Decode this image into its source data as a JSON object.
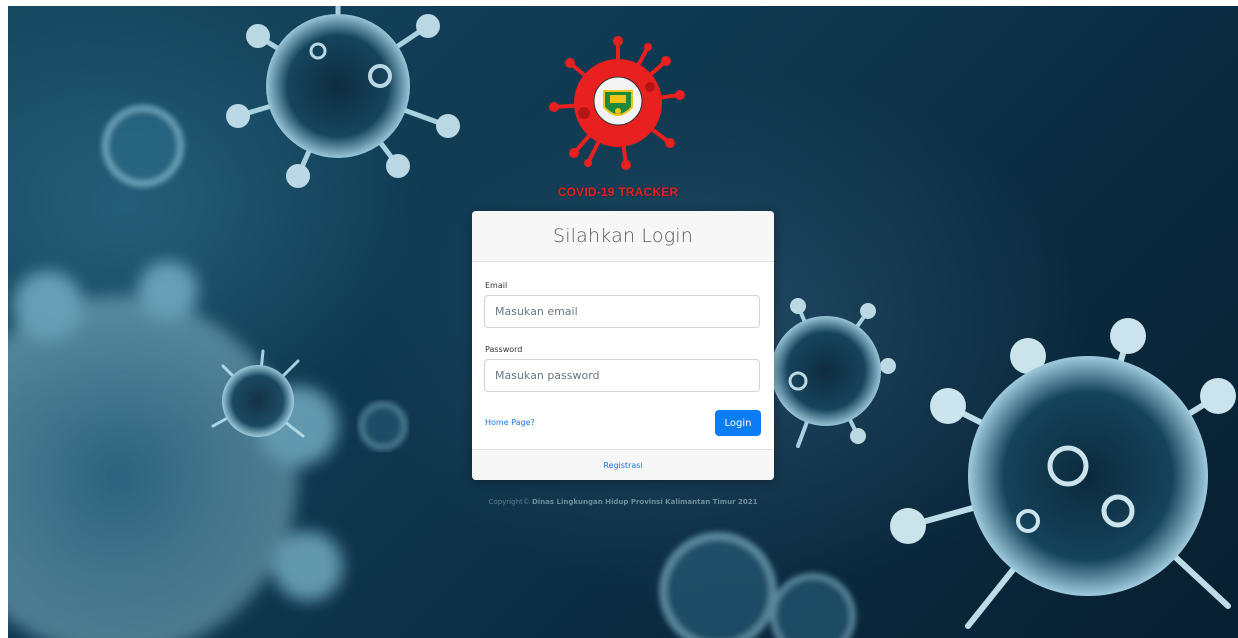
{
  "brand": {
    "title": "COVID-19 TRACKER",
    "primary_color": "#e8201f",
    "emblem_color": "#1c8a3a",
    "emblem_accent": "#f2c318"
  },
  "login_card": {
    "heading": "Silahkan Login",
    "email_label": "Email",
    "email_placeholder": "Masukan email",
    "email_value": "",
    "password_label": "Password",
    "password_placeholder": "Masukan password",
    "password_value": "",
    "home_link": "Home Page?",
    "login_button": "Login",
    "login_button_color": "#0a7cf5",
    "register_link": "Registrasi"
  },
  "footer": {
    "copyright_prefix": "Copyright© ",
    "copyright_org": "Dinas Lingkungan Hidup Provinsi Kalimantan Timur 2021"
  },
  "background": {
    "theme": "virus-illustration",
    "base_color": "#0f3a52"
  }
}
